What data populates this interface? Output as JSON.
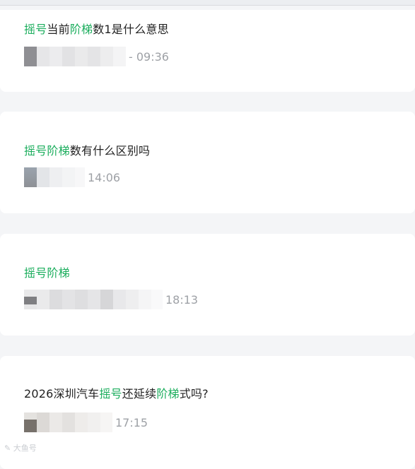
{
  "questions": [
    {
      "title_parts": [
        {
          "text": "摇号",
          "hl": true
        },
        {
          "text": "当前",
          "hl": false
        },
        {
          "text": "阶梯",
          "hl": true
        },
        {
          "text": "数1是什么意思",
          "hl": false
        }
      ],
      "time": "- 09:36"
    },
    {
      "title_parts": [
        {
          "text": "摇号阶梯",
          "hl": true
        },
        {
          "text": "数有什么区别吗",
          "hl": false
        }
      ],
      "time": "14:06"
    },
    {
      "title_parts": [
        {
          "text": "摇号阶梯",
          "hl": true
        }
      ],
      "time": "18:13"
    },
    {
      "title_parts": [
        {
          "text": "2026深圳汽车",
          "hl": false
        },
        {
          "text": "摇号",
          "hl": true
        },
        {
          "text": "还延续",
          "hl": false
        },
        {
          "text": "阶梯",
          "hl": true
        },
        {
          "text": "式吗?",
          "hl": false
        }
      ],
      "time": "17:15"
    }
  ],
  "watermark": "大鱼号"
}
